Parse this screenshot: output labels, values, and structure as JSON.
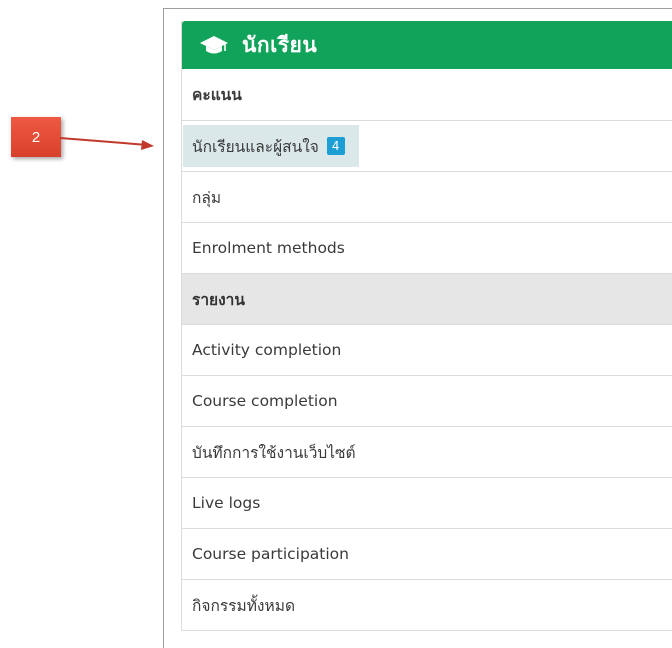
{
  "callout": {
    "number": "2"
  },
  "panel": {
    "title": "นักเรียน",
    "header_icon": "graduation-cap-icon",
    "header_color": "#12a35a",
    "items": [
      {
        "label": "คะแนน"
      },
      {
        "label": "นักเรียนและผู้สนใจ",
        "badge": "4"
      },
      {
        "label": "กลุ่ม"
      },
      {
        "label": "Enrolment methods"
      },
      {
        "label": "รายงาน"
      },
      {
        "label": "Activity completion"
      },
      {
        "label": "Course completion"
      },
      {
        "label": "บันทึกการใช้งานเว็บไซต์"
      },
      {
        "label": "Live logs"
      },
      {
        "label": "Course participation"
      },
      {
        "label": "กิจกรรมทั้งหมด"
      }
    ]
  }
}
